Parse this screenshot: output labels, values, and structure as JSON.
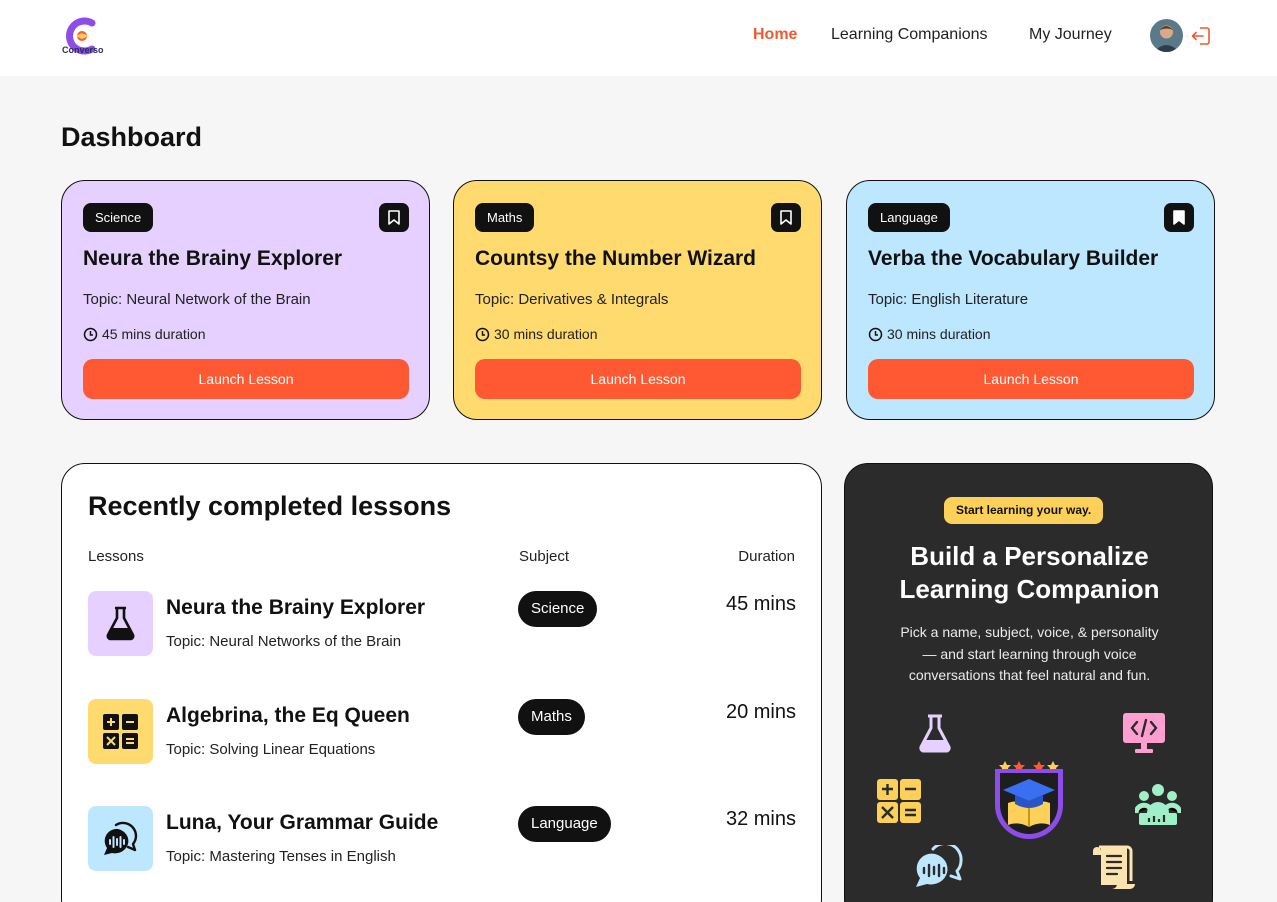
{
  "brand": {
    "name": "Converso"
  },
  "nav": {
    "links": [
      {
        "label": "Home",
        "active": true
      },
      {
        "label": "Learning Companions",
        "active": false
      },
      {
        "label": "My Journey",
        "active": false
      }
    ]
  },
  "dashboard": {
    "title": "Dashboard"
  },
  "cards": [
    {
      "subject": "Science",
      "title": "Neura the Brainy Explorer",
      "topic": "Topic: Neural Network of the Brain",
      "duration": "45 mins duration",
      "button": "Launch Lesson",
      "color": "#e5d0ff",
      "bookmarked": false
    },
    {
      "subject": "Maths",
      "title": "Countsy the Number Wizard",
      "topic": "Topic: Derivatives & Integrals",
      "duration": "30 mins duration",
      "button": "Launch Lesson",
      "color": "#ffda6e",
      "bookmarked": false
    },
    {
      "subject": "Language",
      "title": "Verba the Vocabulary Builder",
      "topic": "Topic: English Literature",
      "duration": "30 mins duration",
      "button": "Launch Lesson",
      "color": "#bde7ff",
      "bookmarked": true
    }
  ],
  "recent": {
    "title": "Recently completed lessons",
    "columns": {
      "lessons": "Lessons",
      "subject": "Subject",
      "duration": "Duration"
    },
    "rows": [
      {
        "title": "Neura the Brainy Explorer",
        "topic": "Topic: Neural Networks of the Brain",
        "subject": "Science",
        "duration": "45 mins",
        "icon": "flask-icon",
        "color": "#e5d0ff"
      },
      {
        "title": "Algebrina, the Eq Queen",
        "topic": "Topic: Solving Linear Equations",
        "subject": "Maths",
        "duration": "20 mins",
        "icon": "calculator-icon",
        "color": "#ffda6e"
      },
      {
        "title": "Luna, Your Grammar Guide",
        "topic": "Topic: Mastering Tenses in English",
        "subject": "Language",
        "duration": "32 mins",
        "icon": "speech-bubble-icon",
        "color": "#bde7ff"
      }
    ]
  },
  "cta": {
    "pill": "Start learning your way.",
    "title_line1": "Build a Personalize",
    "title_line2": "Learning Companion",
    "desc_line1": "Pick a name, subject, voice, & personality",
    "desc_line2": "— and start learning through voice",
    "desc_line3": "conversations that feel natural and fun."
  },
  "colors": {
    "accent": "#fe5933",
    "dark": "#2b2b2b",
    "pill": "#fcd059",
    "science": "#e5d0ff",
    "maths": "#ffda6e",
    "language": "#bde7ff"
  }
}
